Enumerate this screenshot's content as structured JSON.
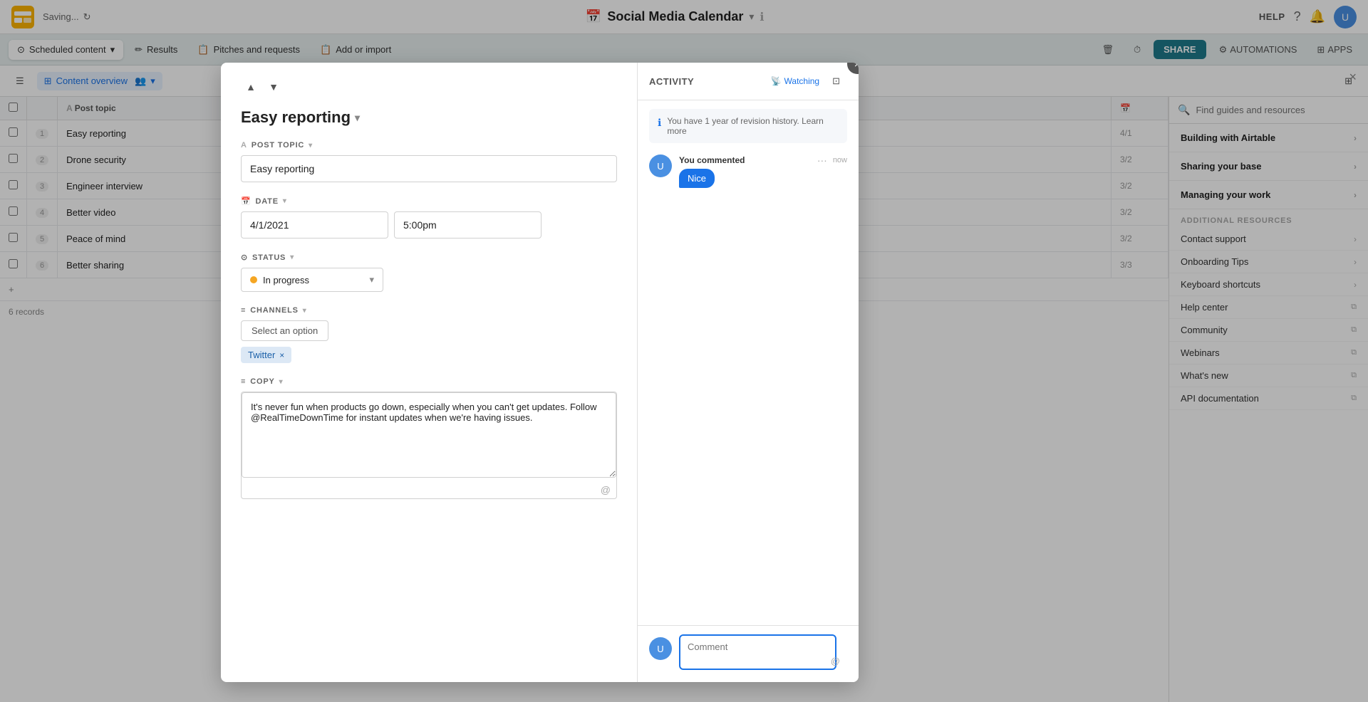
{
  "app": {
    "saving_label": "Saving...",
    "page_title": "Social Media Calendar",
    "help_label": "HELP"
  },
  "top_bar": {
    "save_icon": "💾",
    "calendar_icon": "📅",
    "info_icon": "ℹ",
    "bell_icon": "🔔",
    "help_label": "HELP"
  },
  "toolbar": {
    "scheduled_label": "Scheduled content",
    "results_label": "Results",
    "pitches_label": "Pitches and requests",
    "add_import_label": "Add or import",
    "share_label": "SHARE",
    "automations_label": "AUTOMATIONS",
    "apps_label": "APPS"
  },
  "subtoolbar": {
    "view_label": "Content overview",
    "grid_icon": "⊞"
  },
  "table": {
    "columns": [
      "",
      "",
      "Post topic",
      ""
    ],
    "rows": [
      {
        "num": "1",
        "row_num": "1",
        "topic": "Easy reporting",
        "date": "4/1"
      },
      {
        "num": "2",
        "row_num": "2",
        "topic": "Drone security",
        "date": "3/2"
      },
      {
        "num": "3",
        "row_num": "3",
        "topic": "Engineer interview",
        "date": "3/2"
      },
      {
        "num": "4",
        "row_num": "4",
        "topic": "Better video",
        "date": "3/2"
      },
      {
        "num": "5",
        "row_num": "5",
        "topic": "Peace of mind",
        "date": "3/2"
      },
      {
        "num": "6",
        "row_num": "6",
        "topic": "Better sharing",
        "date": "3/3"
      }
    ],
    "records_count": "6 records"
  },
  "modal": {
    "title": "Easy reporting",
    "title_caret": "▾",
    "close": "×",
    "fields": {
      "post_topic_label": "POST TOPIC",
      "post_topic_value": "Easy reporting",
      "date_label": "DATE",
      "date_value": "4/1/2021",
      "time_value": "5:00pm",
      "status_label": "STATUS",
      "status_value": "In progress",
      "channels_label": "CHANNELS",
      "channels_option_label": "Select an option",
      "channel_tag": "Twitter",
      "copy_label": "COPY",
      "copy_value": "It's never fun when products go down, especially when you can't get updates. Follow @RealTimeDownTime for instant updates when we're having issues."
    }
  },
  "activity": {
    "title": "ACTIVITY",
    "watching_label": "Watching",
    "revision_text": "You have 1 year of revision history. Learn more",
    "comment_user": "You commented",
    "comment_time": "now",
    "comment_text": "Nice",
    "comment_placeholder": "Comment"
  },
  "right_panel": {
    "search_placeholder": "Find guides and resources",
    "sections": [
      {
        "label": "Building with Airtable"
      },
      {
        "label": "Sharing your base"
      },
      {
        "label": "Managing your work"
      }
    ],
    "resources_title": "ADDITIONAL RESOURCES",
    "links": [
      {
        "label": "Contact support",
        "external": false
      },
      {
        "label": "Onboarding Tips",
        "external": false
      },
      {
        "label": "Keyboard shortcuts",
        "external": false
      },
      {
        "label": "Help center",
        "external": true
      },
      {
        "label": "Community",
        "external": true
      },
      {
        "label": "Webinars",
        "external": true
      },
      {
        "label": "What's new",
        "external": true
      },
      {
        "label": "API documentation",
        "external": true
      }
    ]
  }
}
